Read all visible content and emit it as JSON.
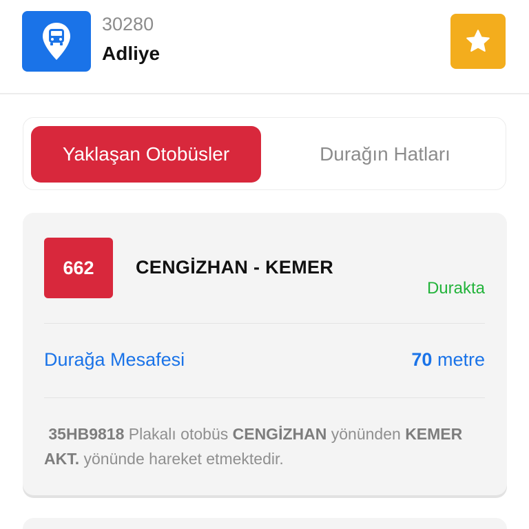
{
  "header": {
    "stop_code": "30280",
    "stop_name": "Adliye",
    "stop_icon": "bus-stop-pin-icon",
    "favorite_icon": "star-icon",
    "colors": {
      "icon_bg": "#1a73e8",
      "favorite_bg": "#f3ad1d"
    }
  },
  "tabs": [
    {
      "label": "Yaklaşan Otobüsler",
      "active": true
    },
    {
      "label": "Durağın Hatları",
      "active": false
    }
  ],
  "arrivals": [
    {
      "line_number": "662",
      "route": "CENGİZHAN - KEMER",
      "status": "Durakta",
      "distance_label": "Durağa Mesafesi",
      "distance_value": "70",
      "distance_unit": "metre",
      "plate": "35HB9818",
      "text_plate_suffix": "Plakalı otobüs",
      "from": "CENGİZHAN",
      "text_from_suffix": "yönünden",
      "to": "KEMER AKT.",
      "text_to_suffix": "yönünde hareket etmektedir."
    }
  ],
  "colors": {
    "accent_red": "#d8283c",
    "link_blue": "#1a73e8",
    "status_green": "#22b33a"
  }
}
